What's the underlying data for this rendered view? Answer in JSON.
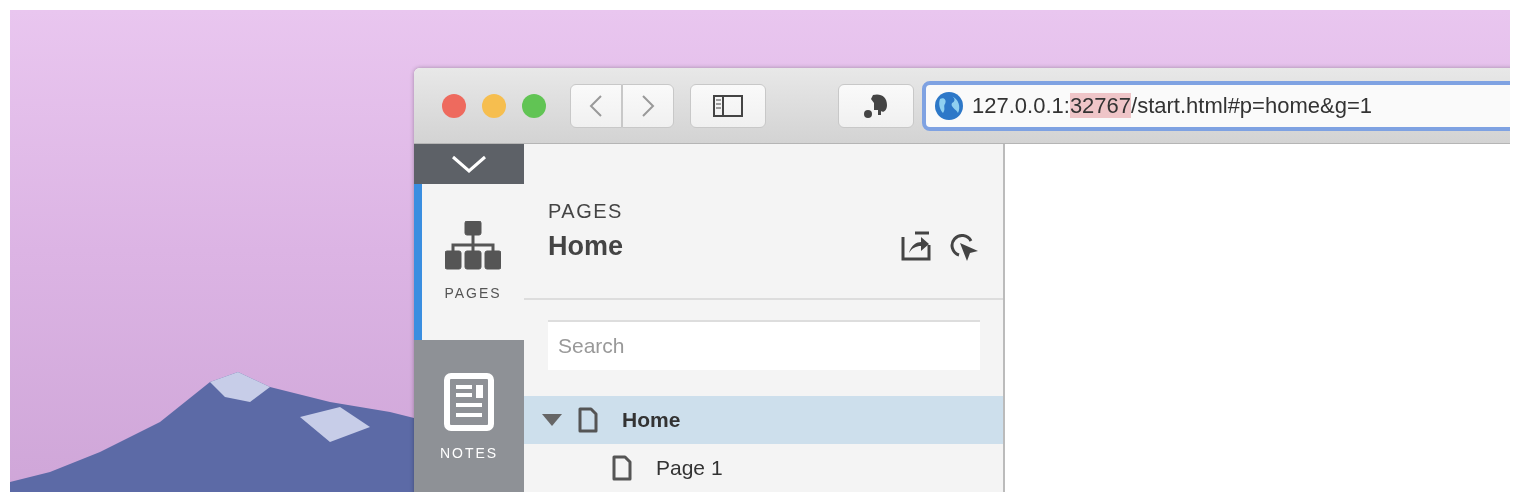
{
  "browser": {
    "address_parts": [
      {
        "text": "127.0.0.1:",
        "selected": false
      },
      {
        "text": "32767",
        "selected": true
      },
      {
        "text": "/start.html#p=home&g=1",
        "selected": false
      }
    ]
  },
  "rail": {
    "tabs": [
      {
        "label": "PAGES",
        "kind": "pages",
        "selected": true
      },
      {
        "label": "NOTES",
        "kind": "notes",
        "selected": false
      }
    ]
  },
  "panel": {
    "heading": "PAGES",
    "title": "Home",
    "search": {
      "placeholder": "Search"
    },
    "tree": [
      {
        "label": "Home",
        "expanded": true,
        "selected": true,
        "children": [
          {
            "label": "Page 1",
            "selected": false
          }
        ]
      }
    ]
  }
}
